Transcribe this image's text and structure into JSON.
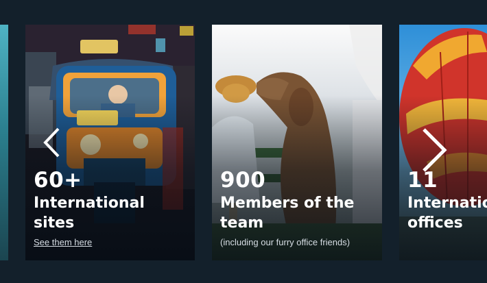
{
  "carousel": {
    "prev_icon": "chevron-left-icon",
    "next_icon": "chevron-right-icon",
    "cards": [
      {
        "number": "60+",
        "label": "International sites",
        "link": "See them here",
        "image": "taxi-tuk-tuk-night-photo"
      },
      {
        "number": "900",
        "label": "Members of the team",
        "note": "(including our furry office friends)",
        "image": "person-with-dog-photo"
      },
      {
        "number": "11",
        "label": "International offices",
        "image": "hot-air-balloon-photo"
      }
    ]
  },
  "colors": {
    "page_background": "#13202b",
    "text": "#ffffff",
    "muted_text": "#d6dde4"
  }
}
